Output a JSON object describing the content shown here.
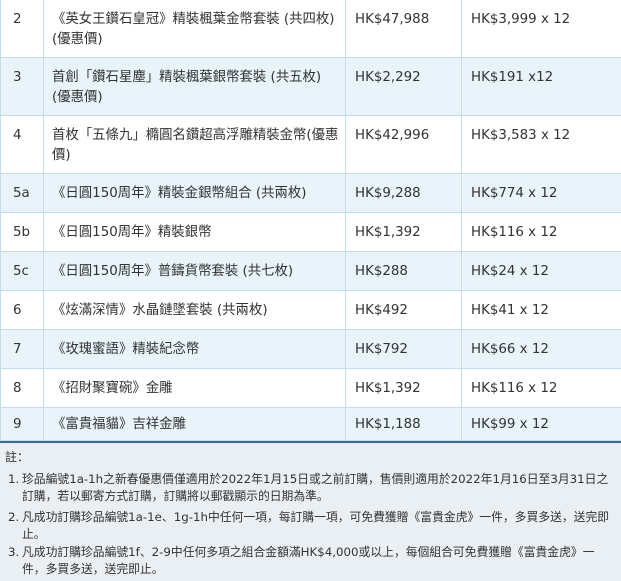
{
  "table": {
    "rows": [
      {
        "num": "2",
        "name": "《英女王鑽石皇冠》精裝楓葉金幣套裝 (共四枚)(優惠價)",
        "price": "HK$47,988",
        "installment": "HK$3,999 x 12"
      },
      {
        "num": "3",
        "name": "首創「鑽石星塵」精裝楓葉銀幣套裝 (共五枚)(優惠價)",
        "price": "HK$2,292",
        "installment": "HK$191 x12"
      },
      {
        "num": "4",
        "name": "首枚「五條九」橢圓名鑽超高浮雕精裝金幣(優惠價)",
        "price": "HK$42,996",
        "installment": "HK$3,583 x 12"
      },
      {
        "num": "5a",
        "name": "《日圓150周年》精裝金銀幣組合 (共兩枚)",
        "price": "HK$9,288",
        "installment": "HK$774 x 12"
      },
      {
        "num": "5b",
        "name": "《日圓150周年》精裝銀幣",
        "price": "HK$1,392",
        "installment": "HK$116 x 12"
      },
      {
        "num": "5c",
        "name": "《日圓150周年》普鑄貨幣套裝 (共七枚)",
        "price": "HK$288",
        "installment": "HK$24 x 12"
      },
      {
        "num": "6",
        "name": "《炫滿深情》水晶鏈墜套裝 (共兩枚)",
        "price": "HK$492",
        "installment": "HK$41 x 12"
      },
      {
        "num": "7",
        "name": "《玫瑰蜜語》精裝紀念幣",
        "price": "HK$792",
        "installment": "HK$66 x 12"
      },
      {
        "num": "8",
        "name": "《招財聚寶碗》金雕",
        "price": "HK$1,392",
        "installment": "HK$116 x 12"
      },
      {
        "num": "9",
        "name": "《富貴福貓》吉祥金雕",
        "price": "HK$1,188",
        "installment": "HK$99 x 12"
      }
    ]
  },
  "notes": {
    "title": "註：",
    "items": [
      {
        "index": "1.",
        "text": "珍品編號1a-1h之新春優惠價僅適用於2022年1月15日或之前訂購，售價則適用於2022年1月16日至3月31日之訂購，若以郵寄方式訂購，訂購將以郵戳顯示的日期為準。"
      },
      {
        "index": "2.",
        "text": "凡成功訂購珍品編號1a-1e、1g-1h中任何一項，每訂購一項，可免費獲贈《富貴金虎》一件，多買多送，送完即止。"
      },
      {
        "index": "3.",
        "text": "凡成功訂購珍品編號1f、2-9中任何多項之組合金額滿HK$4,000或以上，每個組合可免費獲贈《富貴金虎》一件，多買多送，送完即止。"
      }
    ]
  },
  "colors": {
    "stripe": "#e8f4fa",
    "border": "#c5dde9",
    "accent_line": "#3a6e8f",
    "notes_bg": "#e9eff3"
  }
}
